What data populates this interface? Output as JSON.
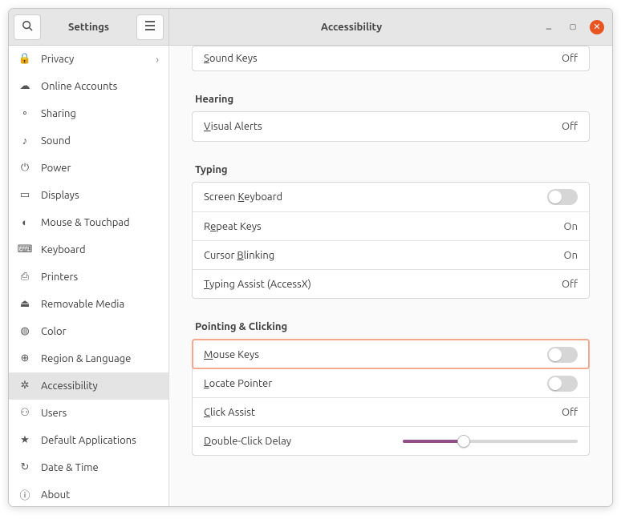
{
  "header": {
    "app_title": "Settings",
    "page_title": "Accessibility"
  },
  "sidebar": {
    "items": [
      {
        "icon": "lock-icon",
        "glyph": "🔒",
        "label": "Privacy",
        "chevron": "›"
      },
      {
        "icon": "cloud-icon",
        "glyph": "☁",
        "label": "Online Accounts"
      },
      {
        "icon": "share-icon",
        "glyph": "∘",
        "label": "Sharing"
      },
      {
        "icon": "sound-icon",
        "glyph": "♪",
        "label": "Sound"
      },
      {
        "icon": "power-icon",
        "glyph": "⏻",
        "label": "Power"
      },
      {
        "icon": "displays-icon",
        "glyph": "▭",
        "label": "Displays"
      },
      {
        "icon": "mouse-icon",
        "glyph": "◐",
        "label": "Mouse & Touchpad"
      },
      {
        "icon": "keyboard-icon",
        "glyph": "⌨",
        "label": "Keyboard"
      },
      {
        "icon": "printers-icon",
        "glyph": "⎙",
        "label": "Printers"
      },
      {
        "icon": "removable-icon",
        "glyph": "⏏",
        "label": "Removable Media"
      },
      {
        "icon": "color-icon",
        "glyph": "◍",
        "label": "Color"
      },
      {
        "icon": "region-icon",
        "glyph": "⊕",
        "label": "Region & Language"
      },
      {
        "icon": "accessibility-icon",
        "glyph": "✲",
        "label": "Accessibility",
        "active": true
      },
      {
        "icon": "users-icon",
        "glyph": "⚇",
        "label": "Users"
      },
      {
        "icon": "apps-icon",
        "glyph": "★",
        "label": "Default Applications"
      },
      {
        "icon": "date-icon",
        "glyph": "↻",
        "label": "Date & Time"
      },
      {
        "icon": "about-icon",
        "glyph": "ⓘ",
        "label": "About"
      }
    ]
  },
  "content": {
    "sections": [
      {
        "title": "",
        "rows": [
          {
            "label_pre": "",
            "label_u": "S",
            "label_post": "ound Keys",
            "value": "Off"
          }
        ]
      },
      {
        "title": "Hearing",
        "rows": [
          {
            "label_pre": "",
            "label_u": "V",
            "label_post": "isual Alerts",
            "value": "Off"
          }
        ]
      },
      {
        "title": "Typing",
        "rows": [
          {
            "label_pre": "Screen ",
            "label_u": "K",
            "label_post": "eyboard",
            "control": "toggle"
          },
          {
            "label_pre": "R",
            "label_u": "e",
            "label_post": "peat Keys",
            "value": "On"
          },
          {
            "label_pre": "Cursor ",
            "label_u": "B",
            "label_post": "linking",
            "value": "On"
          },
          {
            "label_pre": "",
            "label_u": "T",
            "label_post": "yping Assist (AccessX)",
            "value": "Off"
          }
        ]
      },
      {
        "title": "Pointing & Clicking",
        "rows": [
          {
            "label_pre": "",
            "label_u": "M",
            "label_post": "ouse Keys",
            "control": "toggle",
            "highlight": true
          },
          {
            "label_pre": "",
            "label_u": "L",
            "label_post": "ocate Pointer",
            "control": "toggle"
          },
          {
            "label_pre": "",
            "label_u": "C",
            "label_post": "lick Assist",
            "value": "Off"
          },
          {
            "label_pre": "",
            "label_u": "D",
            "label_post": "ouble-Click Delay",
            "control": "slider",
            "slider_pct": 35
          }
        ]
      }
    ]
  }
}
